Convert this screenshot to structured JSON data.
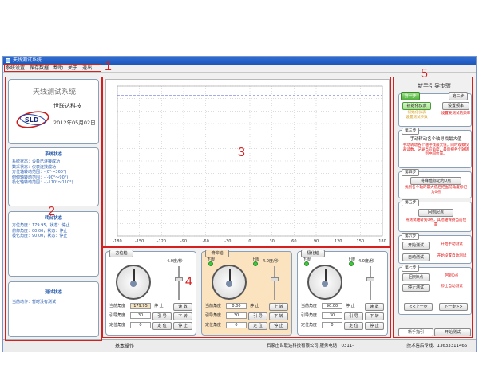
{
  "window": {
    "title": "天线测试系统"
  },
  "menu": [
    "系统设置",
    "保存数据",
    "帮助",
    "关于",
    "退出"
  ],
  "callouts": [
    "1",
    "2",
    "3",
    "4",
    "5"
  ],
  "brand": {
    "system_name": "天线测试系统",
    "company": "世联达科技",
    "logo_text": "SLD",
    "date": "2012年05月02日"
  },
  "system_status": {
    "title": "系统状态",
    "lines": [
      "系统状态：设备已连接成功",
      "数采状态：仪表连接成功",
      "方位轴转动范围：-(0°～360°)",
      "俯仰轴转动范围：-(-90°～90°)",
      "极化轴转动范围：-(-110°～110°)"
    ]
  },
  "turntable": {
    "title": "转台状态",
    "lines": [
      "方位角度：179.95，状态：停止",
      "俯仰角度：00.00，状态：停止",
      "极化角度：90.00，状态：停止"
    ]
  },
  "test_status": {
    "title": "测试状态",
    "line": "当前动作：暂时没有测试"
  },
  "chart_data": {
    "type": "line",
    "x_ticks": [
      "-180",
      "-150",
      "-120",
      "-90",
      "-60",
      "-30",
      "0",
      "30",
      "60",
      "90",
      "120",
      "150",
      "180"
    ],
    "series": [
      {
        "line_style": "dashed",
        "color": "#4a5ad8"
      }
    ]
  },
  "axes": [
    {
      "title": "方位轴",
      "speed": "4.0度/秒",
      "current_label": "当前角度",
      "current": "179.95",
      "stop_label": "停 止",
      "read_btn": "读 数",
      "ref_label": "引导角度",
      "ref": "30",
      "guide_btn": "引 导",
      "down_btn": "下 转",
      "pos_label": "定位角度",
      "pos": "0",
      "pos_btn": "定 位",
      "stop_btn": "停 止",
      "limit_low": "",
      "limit_high": "",
      "highlight": false
    },
    {
      "title": "俯仰轴",
      "speed": "4.0度/秒",
      "current_label": "当前角度",
      "current": "0.00",
      "stop_label": "停 止",
      "read_btn": "上 转",
      "ref_label": "引导角度",
      "ref": "30",
      "guide_btn": "引 导",
      "down_btn": "下 转",
      "pos_label": "定位角度",
      "pos": "0",
      "pos_btn": "定 位",
      "stop_btn": "停 止",
      "limit_low": "下限",
      "limit_high": "上限",
      "highlight": true
    },
    {
      "title": "极化轴",
      "speed": "4.0度/秒",
      "current_label": "当前角度",
      "current": "90.00",
      "stop_label": "停 止",
      "read_btn": "读 数",
      "ref_label": "引导角度",
      "ref": "30",
      "guide_btn": "引 导",
      "down_btn": "下 转",
      "pos_label": "定位角度",
      "pos": "0",
      "pos_btn": "定 位",
      "stop_btn": "停 止",
      "limit_low": "下限",
      "limit_high": "上限",
      "highlight": false
    }
  ],
  "guide": {
    "title": "新手引导步骤",
    "step1": {
      "tag": "第一步",
      "btn": "初始化仪表",
      "note": "初始化仪表",
      "note2": "设置测试参数"
    },
    "step2": {
      "tag": "第二步",
      "btn": "设置频率",
      "note": "设置要测试的频率"
    },
    "step3": {
      "tag": "第三步",
      "heading": "手动转动各个轴寻找最大值",
      "note": "手动转动各个轴寻找最大值，同时观察仪表读数，记录当前角度，最后把各个轴转到中间位置。"
    },
    "step4": {
      "tag": "第四步",
      "btn": "将峰值标记为0点",
      "note": "找到各个轴的最大值后把当前角度标记为0点"
    },
    "step5": {
      "tag": "第五步",
      "btn": "回到起点",
      "note": "将测试轴转到0点，其他轴保持当前位置"
    },
    "step6": {
      "tag": "第六步",
      "btn1": "开始测试",
      "note1": "开始手动测试",
      "btn2": "自动测试",
      "note2": "开始设置自动测试"
    },
    "step7": {
      "tag": "第七步",
      "btn1": "回到0点",
      "note1": "回到0点",
      "btn2": "停止测试",
      "note2": "停止自动测试"
    },
    "nav": {
      "prev": "<<上一步",
      "next": "下一步>>"
    },
    "tabs": [
      "新手指引",
      "开始测试"
    ]
  },
  "status": {
    "mode": "基本操作",
    "company": "石家庄世联达科技有限公司|服务电话：0311-",
    "service": "|技术售后专线：13633311465"
  }
}
